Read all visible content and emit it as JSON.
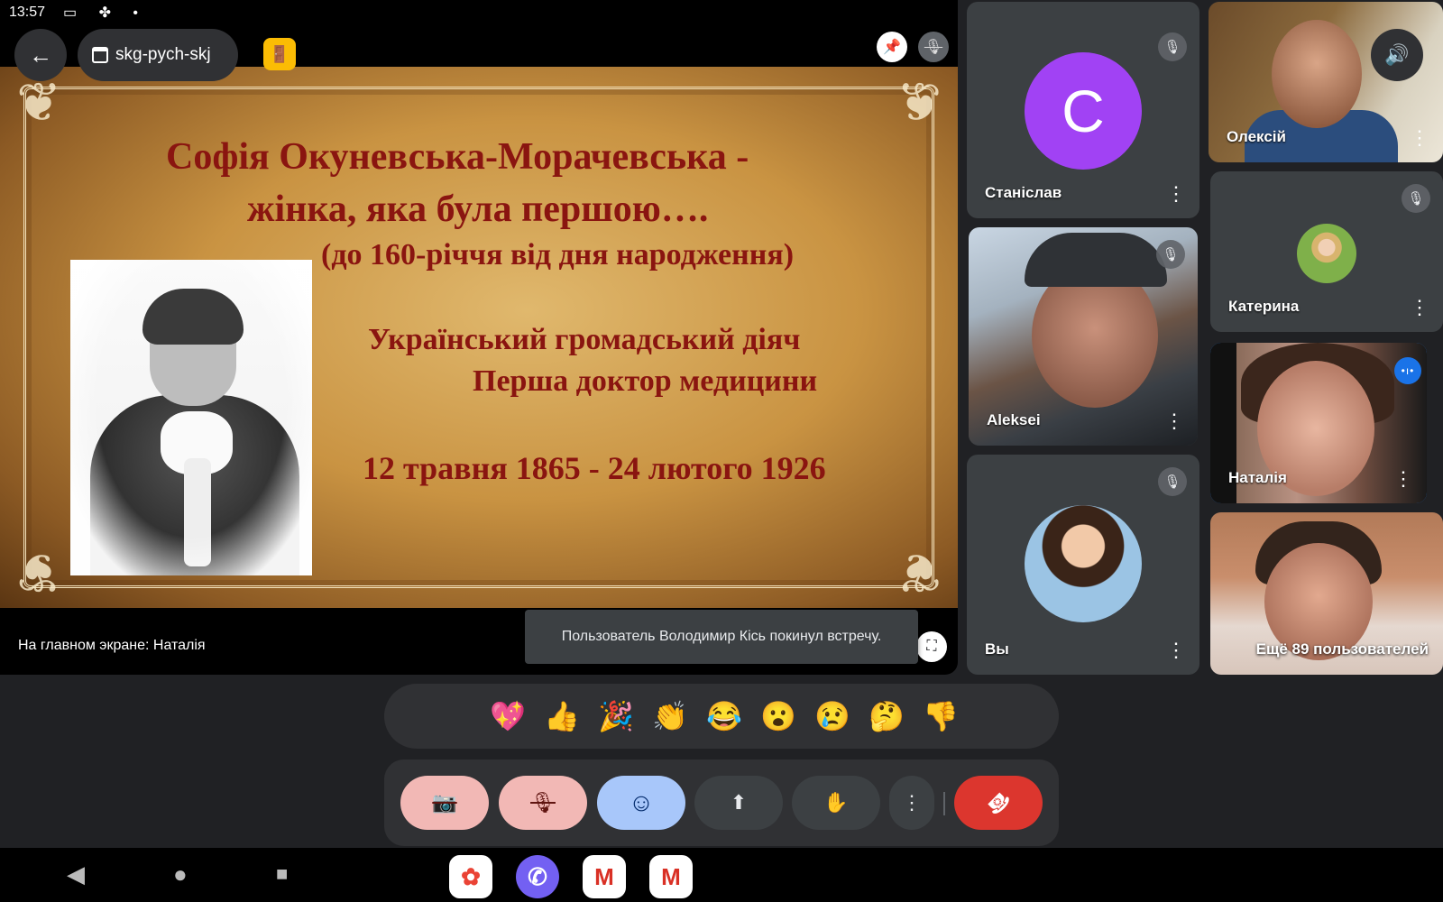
{
  "status_bar": {
    "time": "13:57",
    "left_icons": "▭ ✤ •",
    "right_icons": "✱ ▾ ▮"
  },
  "meeting": {
    "code": "skg-pych-skj"
  },
  "slide": {
    "title_line1": "Софія  Окуневська-Морачевська -",
    "title_line2": "жінка, яка була першою….",
    "subtitle": "(до 160-річчя від дня народження)",
    "line_role1": "Український громадський діяч",
    "line_role2": "Перша доктор медицини",
    "line_dates": "12 травня 1865 - 24 лютого 1926"
  },
  "stage": {
    "caption": "На главном экране: Наталія"
  },
  "toast": {
    "message": "Пользователь Володимир Кісь покинул встречу."
  },
  "participants": {
    "stanislav": {
      "name": "Станіслав",
      "initial": "C",
      "avatar_color": "#a142f4"
    },
    "oleksii": {
      "name": "Олексій"
    },
    "kateryna": {
      "name": "Катерина"
    },
    "aleksei": {
      "name": "Aleksei"
    },
    "natalia": {
      "name": "Наталія"
    },
    "you": {
      "name": "Вы"
    },
    "more": {
      "label": "Ещё 89 пользователей"
    }
  },
  "reactions": [
    "💖",
    "👍",
    "🎉",
    "👏",
    "😂",
    "😮",
    "😢",
    "🤔",
    "👎"
  ],
  "icons": {
    "back": "←",
    "mic_off": "🎙",
    "pin": "📌",
    "fullscreen": "⛶",
    "more": "⋮",
    "volume": "🔊",
    "camera_off": "📷",
    "smile": "☺",
    "present": "⬆",
    "hand": "✋",
    "end_call": "☎",
    "door": "🚪",
    "speaking": "•ı•"
  },
  "nav": {
    "back": "◀",
    "home": "●",
    "recents": "■"
  },
  "dock": [
    {
      "app": "Photos",
      "glyph": "✿",
      "color": "#ffffff"
    },
    {
      "app": "Viber",
      "glyph": "✆",
      "color": "#7360f2"
    },
    {
      "app": "Gmail",
      "glyph": "M",
      "color": "#ffffff"
    },
    {
      "app": "Gmail",
      "glyph": "M",
      "color": "#ffffff"
    }
  ],
  "colors": {
    "accent": "#1a73e8",
    "danger": "#dc362e",
    "slide_text": "#8a1510",
    "muted_button": "#f2b8b5"
  }
}
